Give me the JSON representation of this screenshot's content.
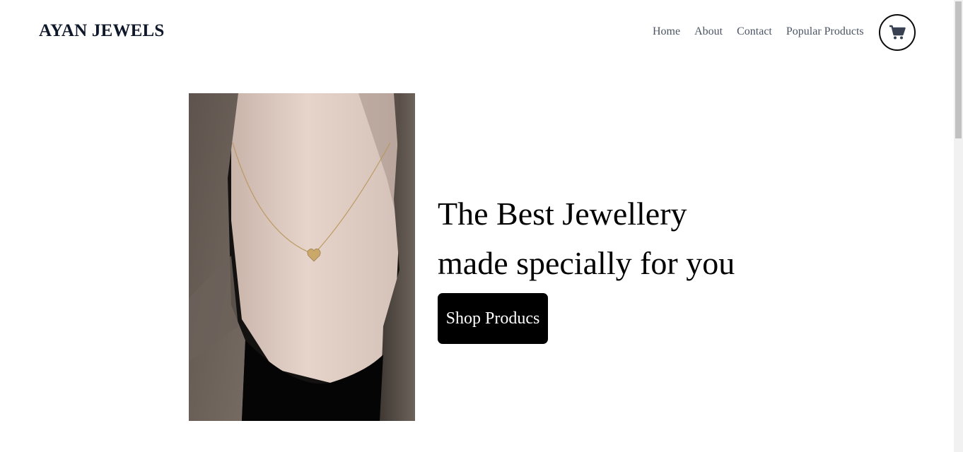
{
  "header": {
    "brand": "AYAN JEWELS",
    "nav": [
      {
        "label": "Home"
      },
      {
        "label": "About"
      },
      {
        "label": "Contact"
      },
      {
        "label": "Popular Products"
      }
    ],
    "cart_icon": "cart-icon"
  },
  "hero": {
    "image": "necklace-photo",
    "headline_line1": "The Best Jewellery",
    "headline_line2": "made specially for you",
    "cta_label": "Shop Producs"
  },
  "colors": {
    "brand_text": "#0f172a",
    "nav_text": "#4b5563",
    "cta_bg": "#000000",
    "cta_text": "#ffffff"
  }
}
